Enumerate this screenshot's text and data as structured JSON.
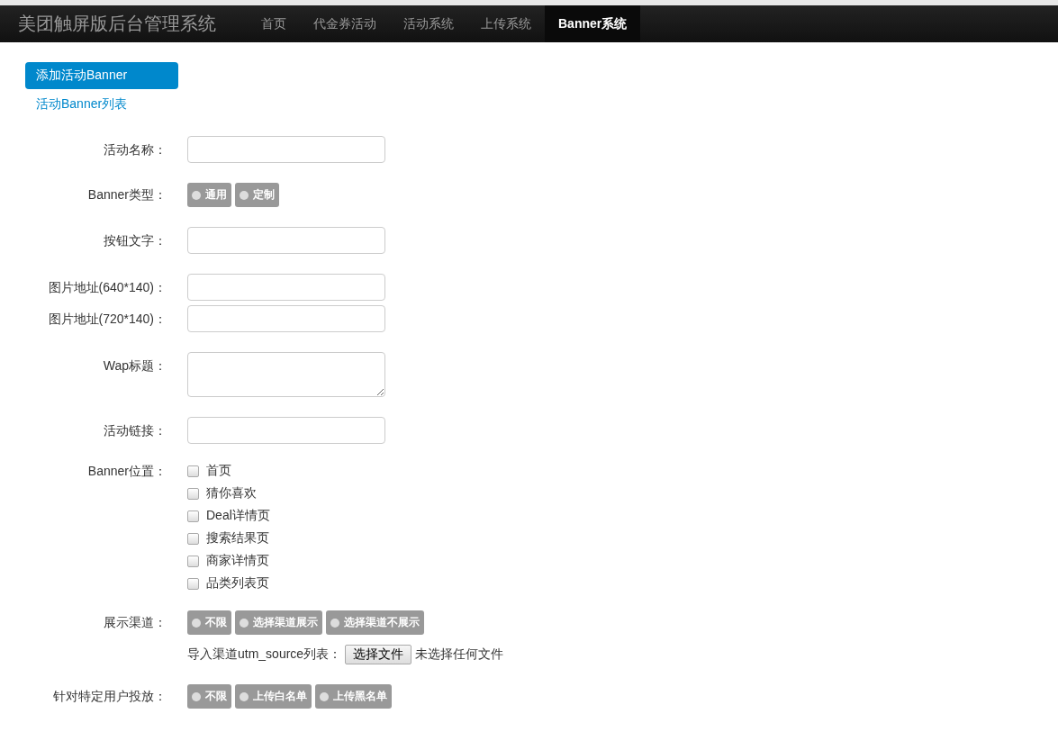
{
  "nav": {
    "brand": "美团触屏版后台管理系统",
    "items": [
      {
        "label": "首页",
        "selected": false
      },
      {
        "label": "代金券活动",
        "selected": false
      },
      {
        "label": "活动系统",
        "selected": false
      },
      {
        "label": "上传系统",
        "selected": false
      },
      {
        "label": "Banner系统",
        "selected": true
      }
    ]
  },
  "sidebar": {
    "items": [
      {
        "label": "添加活动Banner",
        "selected": true
      },
      {
        "label": "活动Banner列表",
        "selected": false
      }
    ]
  },
  "form": {
    "sections": [
      {
        "rows": [
          {
            "kind": "text",
            "label": "活动名称："
          }
        ]
      },
      {
        "rows": [
          {
            "kind": "radio",
            "label": "Banner类型：",
            "options": [
              {
                "label": "通用",
                "selected": false
              },
              {
                "label": "定制",
                "selected": false
              }
            ]
          }
        ]
      },
      {
        "rows": [
          {
            "kind": "text",
            "label": "按钮文字："
          }
        ]
      },
      {
        "rows": [
          {
            "kind": "text",
            "label": "图片地址(640*140)："
          },
          {
            "kind": "text",
            "label": "图片地址(720*140)："
          }
        ]
      },
      {
        "rows": [
          {
            "kind": "textarea",
            "label": "Wap标题："
          }
        ]
      },
      {
        "rows": [
          {
            "kind": "text",
            "label": "活动链接："
          }
        ]
      },
      {
        "rows": [
          {
            "kind": "checkbox",
            "label": "Banner位置：",
            "options": [
              {
                "label": "首页",
                "checked": false
              },
              {
                "label": "猜你喜欢",
                "checked": false
              },
              {
                "label": "Deal详情页",
                "checked": false
              },
              {
                "label": "搜索结果页",
                "checked": false
              },
              {
                "label": "商家详情页",
                "checked": false
              },
              {
                "label": "品类列表页",
                "checked": false
              }
            ]
          }
        ]
      },
      {
        "rows": [
          {
            "kind": "radio",
            "label": "展示渠道：",
            "options": [
              {
                "label": "不限",
                "selected": false
              },
              {
                "label": "选择渠道展示",
                "selected": false
              },
              {
                "label": "选择渠道不展示",
                "selected": false
              }
            ]
          },
          {
            "kind": "file",
            "text": "导入渠道utm_source列表：",
            "button": "选择文件",
            "status": "未选择任何文件"
          }
        ]
      },
      {
        "rows": [
          {
            "kind": "radio",
            "label": "针对特定用户投放：",
            "options": [
              {
                "label": "不限",
                "selected": false
              },
              {
                "label": "上传白名单",
                "selected": false
              },
              {
                "label": "上传黑名单",
                "selected": false
              }
            ]
          }
        ]
      }
    ]
  }
}
